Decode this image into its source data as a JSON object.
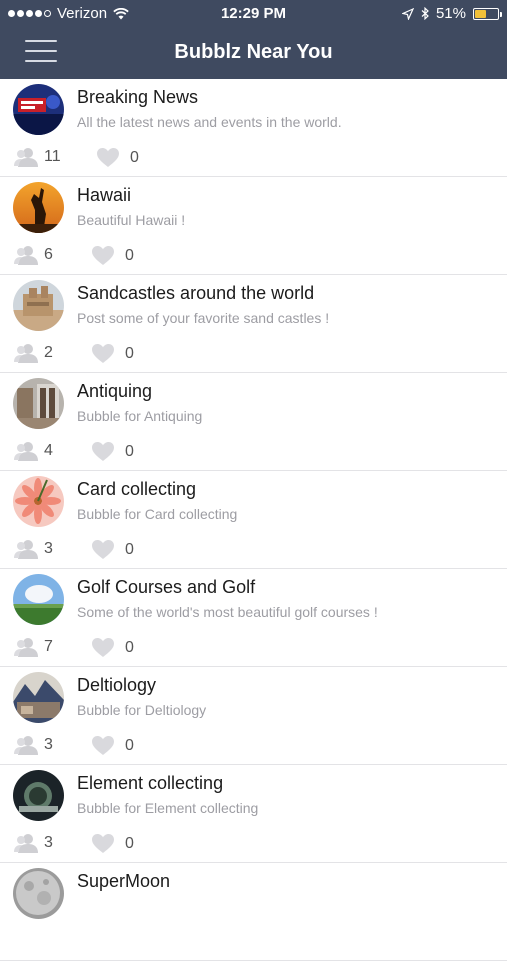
{
  "status": {
    "carrier": "Verizon",
    "time": "12:29 PM",
    "battery": "51%",
    "battery_level": 0.51
  },
  "nav": {
    "title": "Bubblz Near You"
  },
  "colors": {
    "navbar": "#3f4a60",
    "accent_battery": "#f2c13a"
  },
  "items": [
    {
      "title": "Breaking News",
      "desc": "All the latest news and events in the world.",
      "members": "11",
      "likes": "0"
    },
    {
      "title": "Hawaii",
      "desc": "Beautiful Hawaii !",
      "members": "6",
      "likes": "0"
    },
    {
      "title": "Sandcastles around the world",
      "desc": "Post some of your favorite sand castles !",
      "members": "2",
      "likes": "0"
    },
    {
      "title": "Antiquing",
      "desc": "Bubble for Antiquing",
      "members": "4",
      "likes": "0"
    },
    {
      "title": "Card collecting",
      "desc": "Bubble for Card collecting",
      "members": "3",
      "likes": "0"
    },
    {
      "title": "Golf Courses and Golf",
      "desc": "Some of the world's most beautiful golf courses !",
      "members": "7",
      "likes": "0"
    },
    {
      "title": "Deltiology",
      "desc": "Bubble for Deltiology",
      "members": "3",
      "likes": "0"
    },
    {
      "title": "Element collecting",
      "desc": "Bubble for Element collecting",
      "members": "3",
      "likes": "0"
    },
    {
      "title": "SuperMoon",
      "desc": "",
      "members": "",
      "likes": ""
    }
  ]
}
